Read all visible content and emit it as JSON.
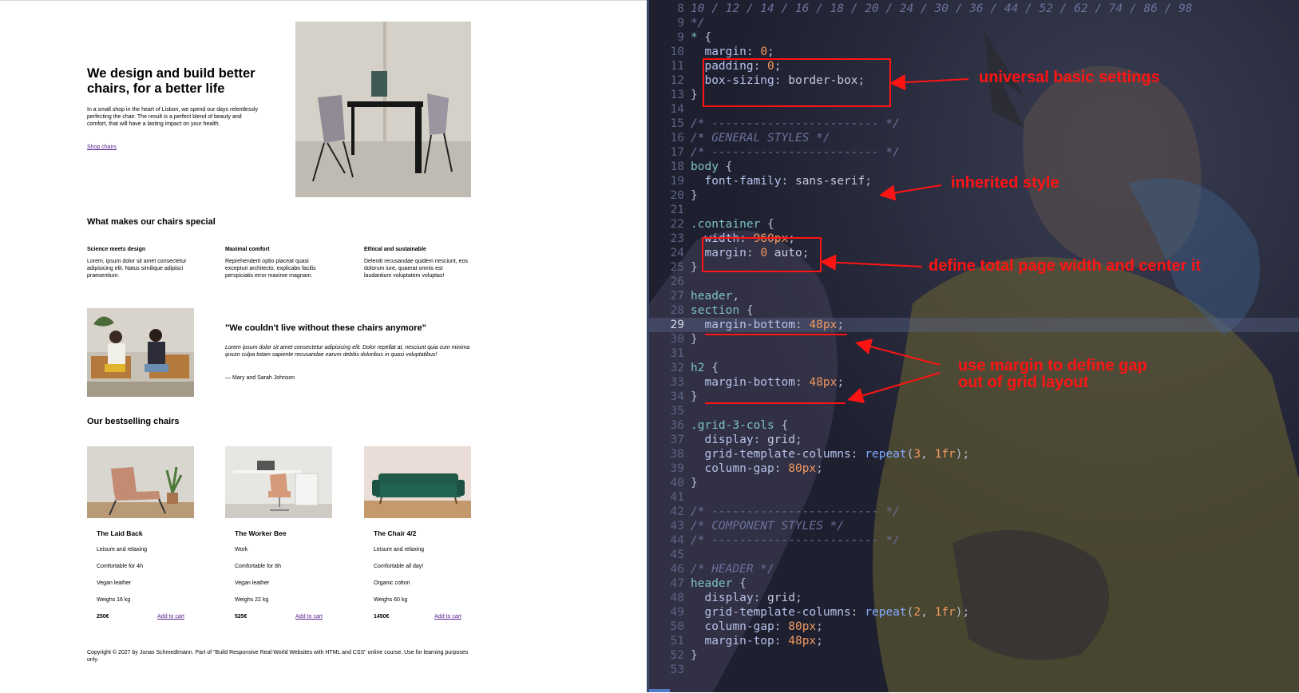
{
  "preview": {
    "hero": {
      "title": "We design and build better chairs, for a better life",
      "text": "In a small shop in the heart of Lisbon, we spend our days relentlessly perfecting the chair. The result is a perfect blend of beauty and comfort, that will have a lasting impact on your health.",
      "link": "Shop chairs"
    },
    "features": {
      "heading": "What makes our chairs special",
      "items": [
        {
          "title": "Science meets design",
          "text": "Lorem, ipsum dolor sit amet consectetur adipisicing elit. Natus similique adipisci praesentium."
        },
        {
          "title": "Maximal comfort",
          "text": "Reprehenderit optio placeat quasi excepturi architecto, explicabo facilis perspiciatis error maxime magnam."
        },
        {
          "title": "Ethical and sustainable",
          "text": "Deleniti recusandae quidem nesciunt, eos dolorum iure, quaerat omnis est laudantium voluptatem voluptas!"
        }
      ]
    },
    "testimonial": {
      "quote": "\"We couldn't live without these chairs anymore\"",
      "text": "Lorem ipsum dolor sit amet consectetur adipisicing elit. Dolor repellat at, nesciunt quia cum minima ipsum culpa totam sapiente recusandae earum debitis doloribus in quasi voluptatibus!",
      "author": "— Mary and Sarah Johnson"
    },
    "bestsellers": {
      "heading": "Our bestselling chairs",
      "cart_label": "Add to cart",
      "products": [
        {
          "name": "The Laid Back",
          "attrs": [
            "Leisure and relaxing",
            "Comfortable for 4h",
            "Vegan leather",
            "Weighs 16 kg"
          ],
          "price": "250€"
        },
        {
          "name": "The Worker Bee",
          "attrs": [
            "Work",
            "Comfortable for 8h",
            "Vegan leather",
            "Weighs 22 kg"
          ],
          "price": "525€"
        },
        {
          "name": "The Chair 4/2",
          "attrs": [
            "Leisure and relaxing",
            "Comfortable all day!",
            "Organic cotton",
            "Weighs 60 kg"
          ],
          "price": "1450€"
        }
      ]
    },
    "copyright": "Copyright © 2027 by Jonas Schmedtmann. Part of \"Build Responsive Real-World Websites with HTML and CSS\" online course. Use for learning purposes only."
  },
  "editor": {
    "active_line": 29,
    "lines": [
      {
        "n": 8,
        "t": [
          [
            "c-com",
            "10 / 12 / 14 / 16 / 18 / 20 / 24 / 30 / 36 / 44 / 52 / 62 / 74 / 86 / 98"
          ]
        ]
      },
      {
        "n": 9,
        "t": [
          [
            "c-com",
            "*/"
          ]
        ]
      },
      {
        "n": 9,
        "t": [
          [
            "c-sel",
            "* "
          ],
          [
            "c-punc",
            "{"
          ]
        ]
      },
      {
        "n": 10,
        "t": [
          [
            "c-prop",
            "  margin"
          ],
          [
            "c-punc",
            ": "
          ],
          [
            "c-num",
            "0"
          ],
          [
            "c-punc",
            ";"
          ]
        ]
      },
      {
        "n": 11,
        "t": [
          [
            "c-prop",
            "  padding"
          ],
          [
            "c-punc",
            ": "
          ],
          [
            "c-num",
            "0"
          ],
          [
            "c-punc",
            ";"
          ]
        ]
      },
      {
        "n": 12,
        "t": [
          [
            "c-prop",
            "  box-sizing"
          ],
          [
            "c-punc",
            ": "
          ],
          [
            "c-kw",
            "border-box"
          ],
          [
            "c-punc",
            ";"
          ]
        ]
      },
      {
        "n": 13,
        "t": [
          [
            "c-punc",
            "}"
          ]
        ]
      },
      {
        "n": 14,
        "t": []
      },
      {
        "n": 15,
        "t": [
          [
            "c-com",
            "/* ------------------------ */"
          ]
        ]
      },
      {
        "n": 16,
        "t": [
          [
            "c-com",
            "/* GENERAL STYLES */"
          ]
        ]
      },
      {
        "n": 17,
        "t": [
          [
            "c-com",
            "/* ------------------------ */"
          ]
        ]
      },
      {
        "n": 18,
        "t": [
          [
            "c-sel",
            "body "
          ],
          [
            "c-punc",
            "{"
          ]
        ]
      },
      {
        "n": 19,
        "t": [
          [
            "c-prop",
            "  font-family"
          ],
          [
            "c-punc",
            ": "
          ],
          [
            "c-kw",
            "sans-serif"
          ],
          [
            "c-punc",
            ";"
          ]
        ]
      },
      {
        "n": 20,
        "t": [
          [
            "c-punc",
            "}"
          ]
        ]
      },
      {
        "n": 21,
        "t": []
      },
      {
        "n": 22,
        "t": [
          [
            "c-sel",
            ".container "
          ],
          [
            "c-punc",
            "{"
          ]
        ]
      },
      {
        "n": 23,
        "t": [
          [
            "c-prop",
            "  width"
          ],
          [
            "c-punc",
            ": "
          ],
          [
            "c-num",
            "960"
          ],
          [
            "c-unit",
            "px"
          ],
          [
            "c-punc",
            ";"
          ]
        ]
      },
      {
        "n": 24,
        "t": [
          [
            "c-prop",
            "  margin"
          ],
          [
            "c-punc",
            ": "
          ],
          [
            "c-num",
            "0 "
          ],
          [
            "c-kw",
            "auto"
          ],
          [
            "c-punc",
            ";"
          ]
        ]
      },
      {
        "n": 25,
        "t": [
          [
            "c-punc",
            "}"
          ]
        ]
      },
      {
        "n": 26,
        "t": []
      },
      {
        "n": 27,
        "t": [
          [
            "c-sel",
            "header"
          ],
          [
            "c-punc",
            ","
          ]
        ]
      },
      {
        "n": 28,
        "t": [
          [
            "c-sel",
            "section "
          ],
          [
            "c-punc",
            "{"
          ]
        ]
      },
      {
        "n": 29,
        "t": [
          [
            "c-prop",
            "  margin-bottom"
          ],
          [
            "c-punc",
            ": "
          ],
          [
            "c-num",
            "48"
          ],
          [
            "c-unit",
            "px"
          ],
          [
            "c-punc",
            ";"
          ]
        ]
      },
      {
        "n": 30,
        "t": [
          [
            "c-punc",
            "}"
          ]
        ]
      },
      {
        "n": 31,
        "t": []
      },
      {
        "n": 32,
        "t": [
          [
            "c-sel",
            "h2 "
          ],
          [
            "c-punc",
            "{"
          ]
        ]
      },
      {
        "n": 33,
        "t": [
          [
            "c-prop",
            "  margin-bottom"
          ],
          [
            "c-punc",
            ": "
          ],
          [
            "c-num",
            "48"
          ],
          [
            "c-unit",
            "px"
          ],
          [
            "c-punc",
            ";"
          ]
        ]
      },
      {
        "n": 34,
        "t": [
          [
            "c-punc",
            "}"
          ]
        ]
      },
      {
        "n": 35,
        "t": []
      },
      {
        "n": 36,
        "t": [
          [
            "c-sel",
            ".grid-3-cols "
          ],
          [
            "c-punc",
            "{"
          ]
        ]
      },
      {
        "n": 37,
        "t": [
          [
            "c-prop",
            "  display"
          ],
          [
            "c-punc",
            ": "
          ],
          [
            "c-kw",
            "grid"
          ],
          [
            "c-punc",
            ";"
          ]
        ]
      },
      {
        "n": 38,
        "t": [
          [
            "c-prop",
            "  grid-template-columns"
          ],
          [
            "c-punc",
            ": "
          ],
          [
            "c-fn",
            "repeat"
          ],
          [
            "c-punc",
            "("
          ],
          [
            "c-num",
            "3"
          ],
          [
            "c-punc",
            ", "
          ],
          [
            "c-num",
            "1"
          ],
          [
            "c-unit",
            "fr"
          ],
          [
            "c-punc",
            ");"
          ]
        ]
      },
      {
        "n": 39,
        "t": [
          [
            "c-prop",
            "  column-gap"
          ],
          [
            "c-punc",
            ": "
          ],
          [
            "c-num",
            "80"
          ],
          [
            "c-unit",
            "px"
          ],
          [
            "c-punc",
            ";"
          ]
        ]
      },
      {
        "n": 40,
        "t": [
          [
            "c-punc",
            "}"
          ]
        ]
      },
      {
        "n": 41,
        "t": []
      },
      {
        "n": 42,
        "t": [
          [
            "c-com",
            "/* ------------------------ */"
          ]
        ]
      },
      {
        "n": 43,
        "t": [
          [
            "c-com",
            "/* COMPONENT STYLES */"
          ]
        ]
      },
      {
        "n": 44,
        "t": [
          [
            "c-com",
            "/* ------------------------ */"
          ]
        ]
      },
      {
        "n": 45,
        "t": []
      },
      {
        "n": 46,
        "t": [
          [
            "c-com",
            "/* HEADER */"
          ]
        ]
      },
      {
        "n": 47,
        "t": [
          [
            "c-sel",
            "header "
          ],
          [
            "c-punc",
            "{"
          ]
        ]
      },
      {
        "n": 48,
        "t": [
          [
            "c-prop",
            "  display"
          ],
          [
            "c-punc",
            ": "
          ],
          [
            "c-kw",
            "grid"
          ],
          [
            "c-punc",
            ";"
          ]
        ]
      },
      {
        "n": 49,
        "t": [
          [
            "c-prop",
            "  grid-template-columns"
          ],
          [
            "c-punc",
            ": "
          ],
          [
            "c-fn",
            "repeat"
          ],
          [
            "c-punc",
            "("
          ],
          [
            "c-num",
            "2"
          ],
          [
            "c-punc",
            ", "
          ],
          [
            "c-num",
            "1"
          ],
          [
            "c-unit",
            "fr"
          ],
          [
            "c-punc",
            ");"
          ]
        ]
      },
      {
        "n": 50,
        "t": [
          [
            "c-prop",
            "  column-gap"
          ],
          [
            "c-punc",
            ": "
          ],
          [
            "c-num",
            "80"
          ],
          [
            "c-unit",
            "px"
          ],
          [
            "c-punc",
            ";"
          ]
        ]
      },
      {
        "n": 51,
        "t": [
          [
            "c-prop",
            "  margin-top"
          ],
          [
            "c-punc",
            ": "
          ],
          [
            "c-num",
            "48"
          ],
          [
            "c-unit",
            "px"
          ],
          [
            "c-punc",
            ";"
          ]
        ]
      },
      {
        "n": 52,
        "t": [
          [
            "c-punc",
            "}"
          ]
        ]
      },
      {
        "n": 53,
        "t": []
      }
    ],
    "annotations": {
      "universal": "universal basic settings",
      "inherited": "inherited style",
      "container": "define total page width and center it",
      "gap_line1": "use margin to define gap",
      "gap_line2": "out of grid layout"
    }
  },
  "colors": {
    "annotation": "#ff1414",
    "editor_bg": "#232536",
    "link": "#551a8b"
  }
}
